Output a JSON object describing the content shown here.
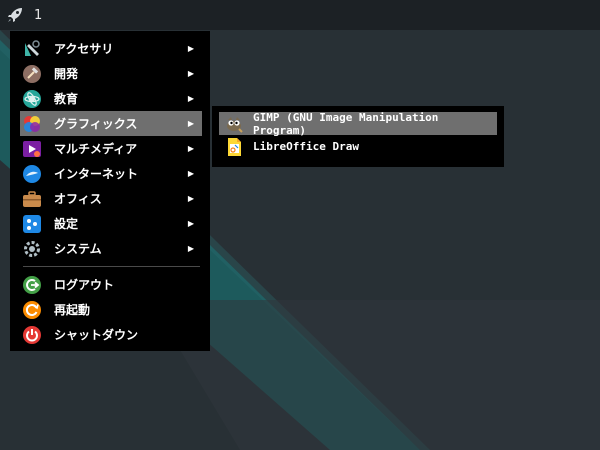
{
  "panel": {
    "workspace": "1",
    "launcher_icon": "rocket-icon"
  },
  "menu": {
    "categories": [
      {
        "label": "アクセサリ",
        "icon": "accessories-icon"
      },
      {
        "label": "開発",
        "icon": "development-icon"
      },
      {
        "label": "教育",
        "icon": "education-icon"
      },
      {
        "label": "グラフィックス",
        "icon": "graphics-icon",
        "active": true
      },
      {
        "label": "マルチメディア",
        "icon": "multimedia-icon"
      },
      {
        "label": "インターネット",
        "icon": "internet-icon"
      },
      {
        "label": "オフィス",
        "icon": "office-icon"
      },
      {
        "label": "設定",
        "icon": "settings-icon"
      },
      {
        "label": "システム",
        "icon": "system-icon"
      }
    ],
    "actions": [
      {
        "label": "ログアウト",
        "icon": "logout-icon"
      },
      {
        "label": "再起動",
        "icon": "reboot-icon"
      },
      {
        "label": "シャットダウン",
        "icon": "shutdown-icon"
      }
    ],
    "submenu_arrow": "▶"
  },
  "submenu": {
    "items": [
      {
        "label": "GIMP (GNU Image Manipulation Program)",
        "icon": "gimp-icon",
        "active": true
      },
      {
        "label": "LibreOffice Draw",
        "icon": "libreoffice-draw-icon"
      }
    ]
  },
  "colors": {
    "wallpaper": "#283035",
    "teal_band": "#1d5a5c",
    "panel": "#1c2125",
    "menu": "#000000",
    "highlight": "#6f6f6f"
  }
}
